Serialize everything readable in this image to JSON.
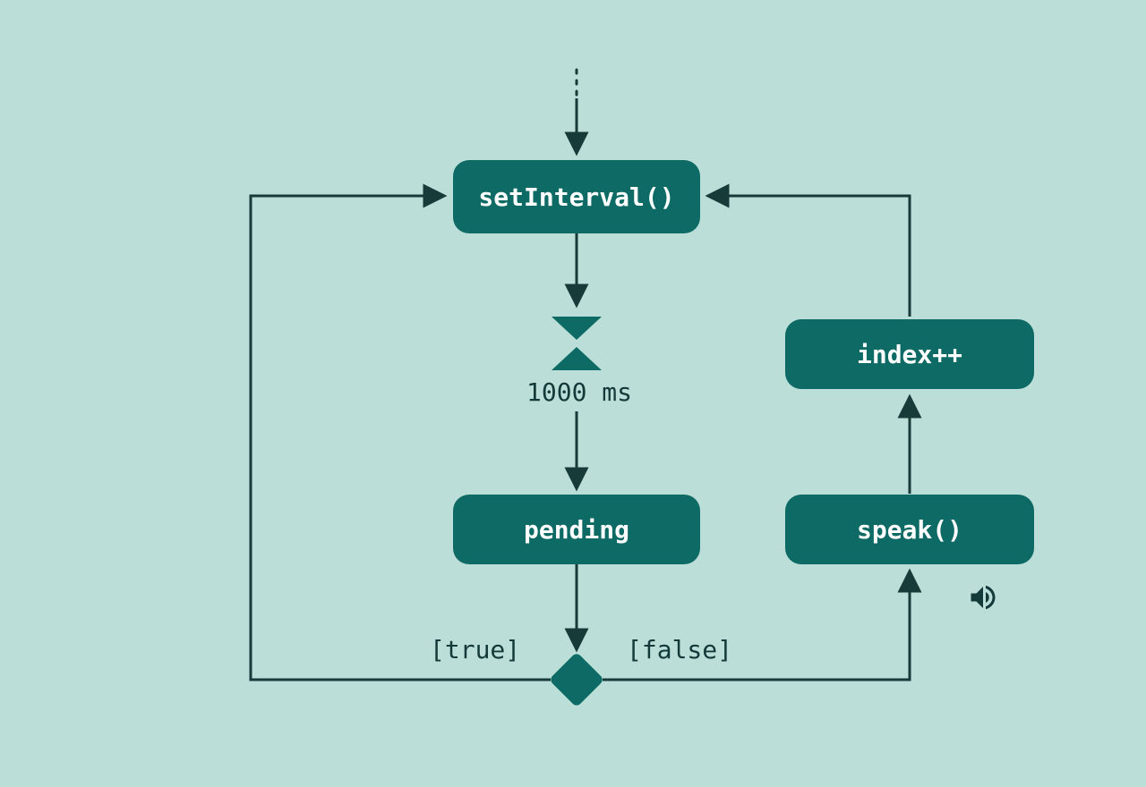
{
  "nodes": {
    "set_interval": "setInterval()",
    "pending": "pending",
    "index_inc": "index++",
    "speak": "speak()"
  },
  "timer_label": "1000 ms",
  "branch_true": "[true]",
  "branch_false": "[false]",
  "colors": {
    "bg": "#bcded9",
    "node": "#0e6a64",
    "stroke": "#163b39"
  }
}
